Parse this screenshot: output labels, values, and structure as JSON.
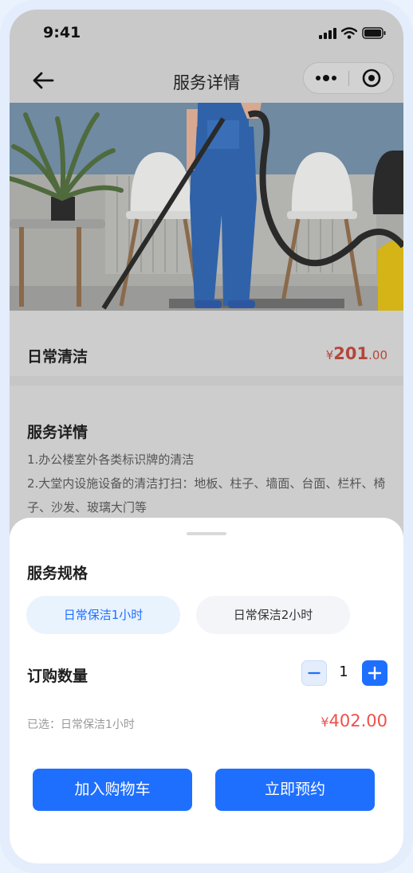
{
  "status_bar": {
    "time": "9:41"
  },
  "nav": {
    "title": "服务详情"
  },
  "service": {
    "name": "日常清洁",
    "price_symbol": "¥",
    "price_integer": "201",
    "price_decimal": ".00"
  },
  "details": {
    "title": "服务详情",
    "line1": "1.办公楼室外各类标识牌的清洁",
    "line2": "2.大堂内设施设备的清洁打扫：地板、柱子、墙面、台面、栏杆、椅子、沙发、玻璃大门等"
  },
  "sheet": {
    "spec_label": "服务规格",
    "specs": [
      {
        "label": "日常保洁1小时",
        "selected": true
      },
      {
        "label": "日常保洁2小时",
        "selected": false
      }
    ],
    "quantity_label": "订购数量",
    "quantity": "1",
    "selected_text": "已选：日常保洁1小时",
    "total_symbol": "¥",
    "total": "402.00",
    "add_to_cart": "加入购物车",
    "book_now": "立即预约"
  },
  "colors": {
    "accent": "#1f6fff",
    "price_red": "#f0504a",
    "overlay_gray": "#c6c6c6"
  }
}
